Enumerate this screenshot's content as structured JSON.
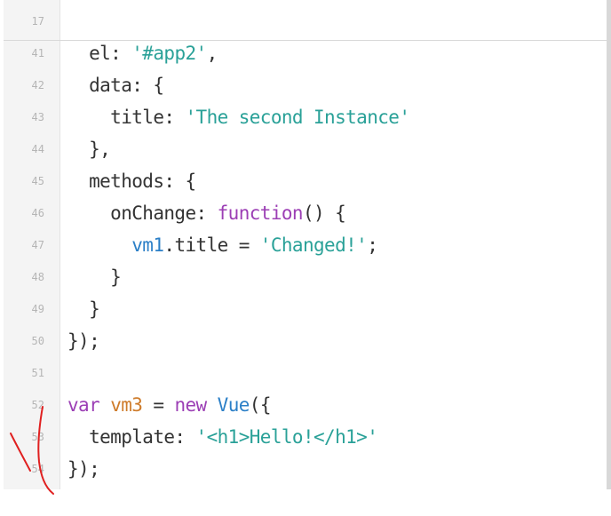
{
  "editor": {
    "lines": [
      {
        "num": "17",
        "parts": []
      },
      {
        "num": "41",
        "parts": [
          [
            "p",
            "  el: "
          ],
          [
            "str",
            "'#app2'"
          ],
          [
            "p",
            ","
          ]
        ]
      },
      {
        "num": "42",
        "parts": [
          [
            "p",
            "  data: {"
          ]
        ]
      },
      {
        "num": "43",
        "parts": [
          [
            "p",
            "    title: "
          ],
          [
            "str",
            "'The second Instance'"
          ]
        ]
      },
      {
        "num": "44",
        "parts": [
          [
            "p",
            "  },"
          ]
        ]
      },
      {
        "num": "45",
        "parts": [
          [
            "p",
            "  methods: {"
          ]
        ]
      },
      {
        "num": "46",
        "parts": [
          [
            "p",
            "    onChange: "
          ],
          [
            "kw",
            "function"
          ],
          [
            "p",
            "() {"
          ]
        ]
      },
      {
        "num": "47",
        "parts": [
          [
            "p",
            "      "
          ],
          [
            "vm",
            "vm1"
          ],
          [
            "p",
            ".title = "
          ],
          [
            "str",
            "'Changed!'"
          ],
          [
            "p",
            ";"
          ]
        ]
      },
      {
        "num": "48",
        "parts": [
          [
            "p",
            "    }"
          ]
        ]
      },
      {
        "num": "49",
        "parts": [
          [
            "p",
            "  }"
          ]
        ]
      },
      {
        "num": "50",
        "parts": [
          [
            "p",
            "});"
          ]
        ]
      },
      {
        "num": "51",
        "parts": []
      },
      {
        "num": "52",
        "parts": [
          [
            "kw",
            "var"
          ],
          [
            "p",
            " "
          ],
          [
            "var",
            "vm3"
          ],
          [
            "p",
            " = "
          ],
          [
            "kw",
            "new"
          ],
          [
            "p",
            " "
          ],
          [
            "cls",
            "Vue"
          ],
          [
            "p",
            "({"
          ]
        ]
      },
      {
        "num": "53",
        "parts": [
          [
            "p",
            "  template: "
          ],
          [
            "str",
            "'<h1>Hello!</h1>'"
          ]
        ]
      },
      {
        "num": "54",
        "parts": [
          [
            "p",
            "});"
          ]
        ]
      }
    ]
  },
  "colors": {
    "string": "#2aa198",
    "keyword": "#9c3fb5",
    "variable": "#ce7b2a",
    "class": "#2b7fc7",
    "plain": "#333333",
    "annotation": "#e02020"
  }
}
